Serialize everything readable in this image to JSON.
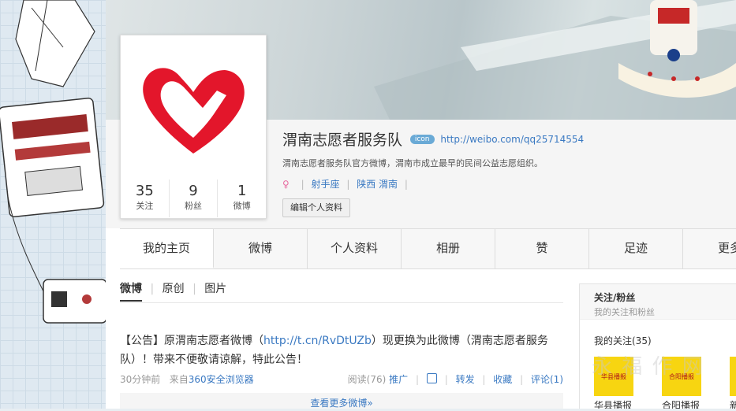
{
  "profile": {
    "name": "渭南志愿者服务队",
    "badge": "icon",
    "url": "http://weibo.com/qq25714554",
    "description": "渭南志愿者服务队官方微博，渭南市成立最早的民间公益志愿组织。",
    "tags": [
      "射手座",
      "陕西 渭南"
    ],
    "edit_button": "编辑个人资料",
    "stats": [
      {
        "num": "35",
        "label": "关注"
      },
      {
        "num": "9",
        "label": "粉丝"
      },
      {
        "num": "1",
        "label": "微博"
      }
    ]
  },
  "tabs": [
    "我的主页",
    "微博",
    "个人资料",
    "相册",
    "赞",
    "足迹",
    "更多"
  ],
  "feed": {
    "subtabs": [
      "微博",
      "原创",
      "图片"
    ],
    "post": {
      "prefix": "【公告】原渭南志愿者微博（",
      "link": "http://t.cn/RvDtUZb",
      "suffix": "）现更换为此微博（渭南志愿者服务队）！带来不便敬请谅解，特此公告！",
      "time": "30分钟前",
      "from_label": "来自",
      "source": "360安全浏览器",
      "read": "阅读(76)",
      "promote": "推广",
      "forward": "转发",
      "favorite": "收藏",
      "comment": "评论(1)"
    },
    "more": "查看更多微博»"
  },
  "sidebar": {
    "title": "关注/粉丝",
    "subtitle": "我的关注和粉丝",
    "follow_count": "我的关注(35)",
    "follows": [
      {
        "name": "华县播报",
        "logo": "华县播报"
      },
      {
        "name": "合阳播报",
        "logo": "合阳播报"
      },
      {
        "name": "新",
        "logo": ""
      }
    ]
  },
  "watermark": "永 福 作 网"
}
